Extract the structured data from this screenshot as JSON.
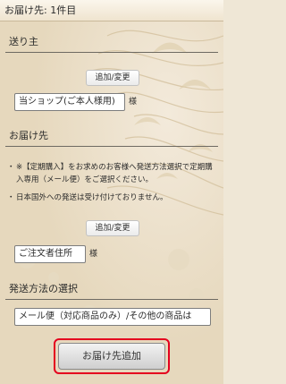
{
  "header": {
    "title": "お届け先: 1件目"
  },
  "sender": {
    "heading": "送り主",
    "change_button": "追加/変更",
    "selected": "当ショップ(ご本人様用)",
    "suffix": "様"
  },
  "recipient": {
    "heading": "お届け先",
    "notes": [
      {
        "bullet": "・",
        "text": "※【定期購入】をお求めのお客様へ発送方法選択で定期購入専用（メール便）をご選択ください。"
      },
      {
        "bullet": "・",
        "text": "日本国外への発送は受け付けておりません。"
      }
    ],
    "change_button": "追加/変更",
    "selected": "ご注文者住所",
    "suffix": "様"
  },
  "shipping": {
    "heading": "発送方法の選択",
    "selected": "メール便（対応商品のみ）/その他の商品は"
  },
  "actions": {
    "add_recipient_label": "お届け先追加"
  },
  "colors": {
    "highlight": "#e4001e",
    "background": "#efe7d6"
  }
}
